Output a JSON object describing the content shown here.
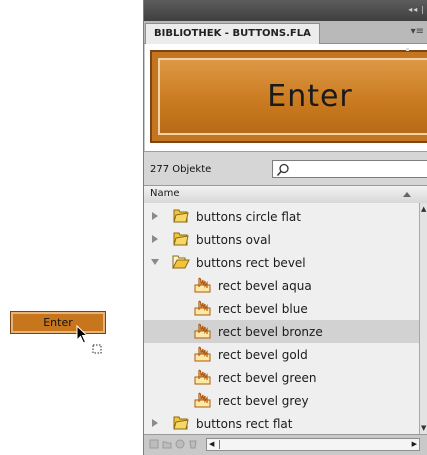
{
  "stage": {
    "button_label": "Enter"
  },
  "panel": {
    "strip_controls": [
      "◂◂",
      "|"
    ],
    "tab_title": "BIBLIOTHEK - BUTTONS.FLA",
    "menu_glyph": "▾≡",
    "preview_label": "Enter",
    "item_count": "277 Objekte",
    "search": {
      "value": "",
      "placeholder": ""
    },
    "column_name": "Name",
    "rows": [
      {
        "label": "buttons circle flat",
        "type": "folder",
        "expanded": false,
        "indent": 0
      },
      {
        "label": "buttons oval",
        "type": "folder",
        "expanded": false,
        "indent": 0
      },
      {
        "label": "buttons rect bevel",
        "type": "folder",
        "expanded": true,
        "indent": 0
      },
      {
        "label": "rect bevel aqua",
        "type": "button-symbol",
        "indent": 1
      },
      {
        "label": "rect bevel blue",
        "type": "button-symbol",
        "indent": 1
      },
      {
        "label": "rect bevel bronze",
        "type": "button-symbol",
        "indent": 1,
        "selected": true
      },
      {
        "label": "rect bevel gold",
        "type": "button-symbol",
        "indent": 1
      },
      {
        "label": "rect bevel green",
        "type": "button-symbol",
        "indent": 1
      },
      {
        "label": "rect bevel grey",
        "type": "button-symbol",
        "indent": 1
      },
      {
        "label": "buttons rect flat",
        "type": "folder",
        "expanded": false,
        "indent": 0
      }
    ]
  },
  "colors": {
    "accent_bronze": "#c9791f",
    "selected_row": "#d2d2d2",
    "folder": "#f2c43a"
  },
  "icons": [
    "folder-icon",
    "open-folder-icon",
    "button-symbol-icon",
    "search-icon",
    "arrow-cursor-icon"
  ]
}
